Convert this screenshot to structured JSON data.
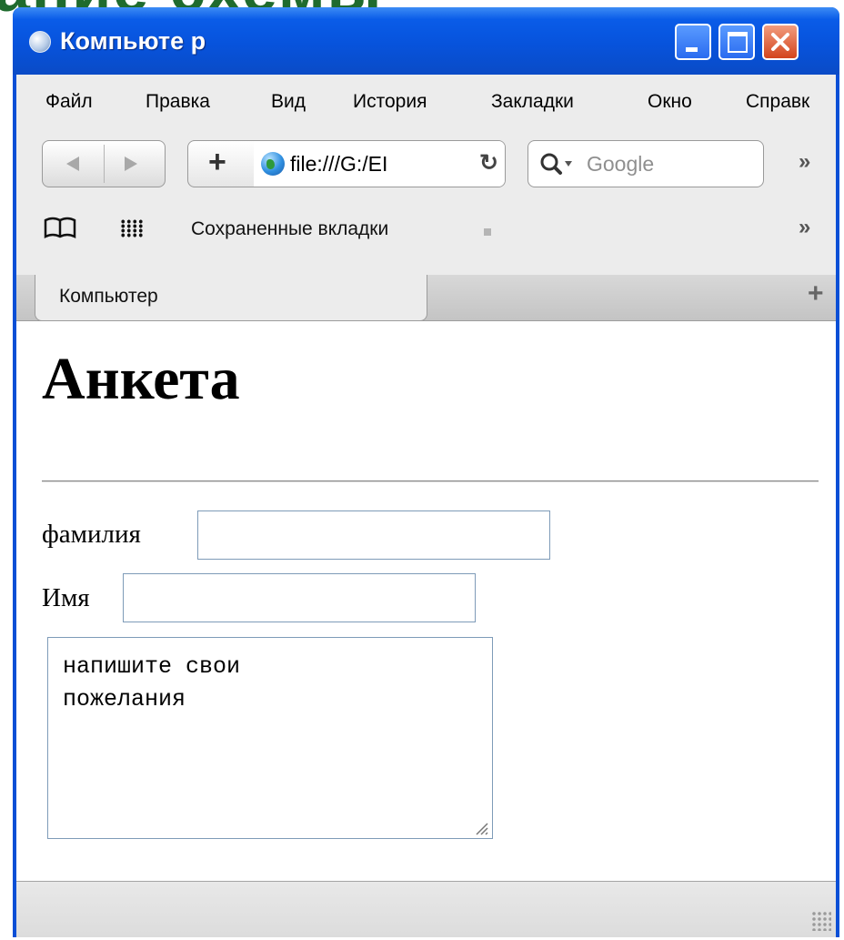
{
  "slide_title": "ание схемы",
  "window": {
    "title": "Компьюте р"
  },
  "menu": [
    "Файл",
    "Правка",
    "Вид",
    "История",
    "Закладки",
    "Окно",
    "Справк"
  ],
  "toolbar": {
    "address": "file:///G:/EI",
    "search_placeholder": "Google",
    "overflow": "»"
  },
  "bookmarks": {
    "label": "Сохраненные вкладки",
    "overflow": "»"
  },
  "tab": {
    "label": "Компьютер",
    "new_tab": "+"
  },
  "page": {
    "heading": "Анкета",
    "fields": [
      {
        "label": "фамилия",
        "value": ""
      },
      {
        "label": "Имя",
        "value": ""
      }
    ],
    "textarea": "напишите свои\nпожелания"
  }
}
